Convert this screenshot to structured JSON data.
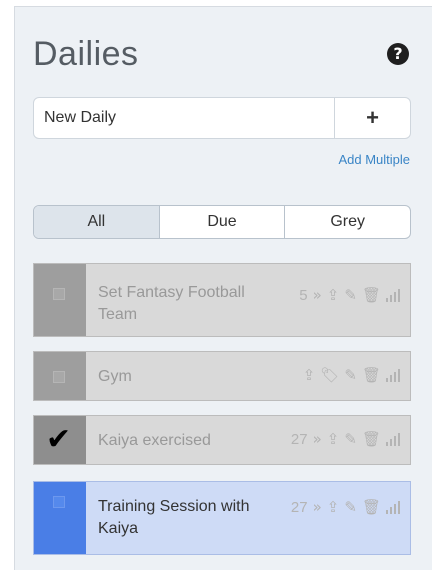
{
  "header": {
    "title": "Dailies",
    "help_icon": "?"
  },
  "add": {
    "placeholder": "New Daily",
    "value": "New Daily",
    "button": "+",
    "multiple": "Add Multiple"
  },
  "filters": [
    {
      "label": "All",
      "active": true
    },
    {
      "label": "Due",
      "active": false
    },
    {
      "label": "Grey",
      "active": false
    }
  ],
  "tasks": [
    {
      "text": "Set Fantasy Football Team",
      "count": "5",
      "checked": false,
      "color": "grey"
    },
    {
      "text": "Gym",
      "count": "",
      "checked": false,
      "color": "grey"
    },
    {
      "text": "Kaiya exercised",
      "count": "27",
      "checked": true,
      "color": "grey"
    },
    {
      "text": "Training Session with Kaiya",
      "count": "27",
      "checked": false,
      "color": "blue"
    }
  ],
  "icons": {
    "streak": "fast-forward-icon",
    "push": "upload-icon",
    "tag": "tag-icon",
    "edit": "pencil-icon",
    "delete": "trash-icon",
    "chart": "bar-chart-icon"
  }
}
